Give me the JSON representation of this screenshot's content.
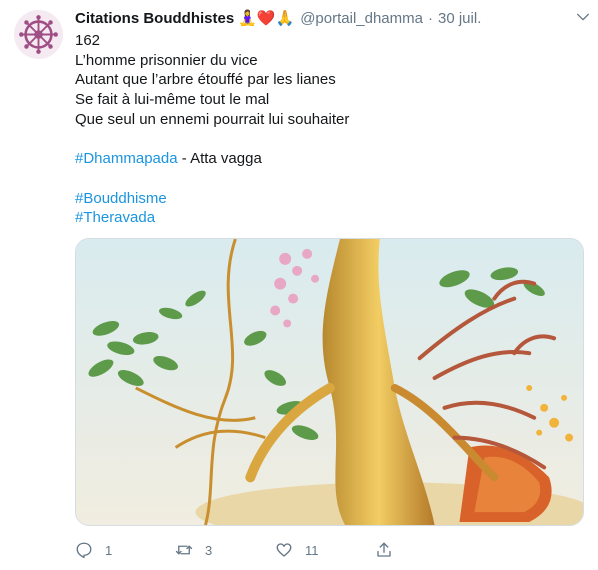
{
  "tweet": {
    "author_name": "Citations Bouddhistes",
    "author_emoji": "🧘‍♀️❤️🙏",
    "handle": "@portail_dhamma",
    "separator": "·",
    "date": "30 juil.",
    "lines": [
      "162",
      "L’homme prisonnier du vice",
      "Autant que l’arbre étouffé par les lianes",
      "Se fait à lui-même tout le mal",
      "Que seul un ennemi pourrait lui souhaiter"
    ],
    "hashtag_dhammapada": "#Dhammapada",
    "after_hashtag": " - Atta vagga",
    "hashtag_bouddhisme": "#Bouddhisme",
    "hashtag_theravada": "#Theravada"
  },
  "actions": {
    "reply_count": "1",
    "retweet_count": "3",
    "like_count": "11"
  },
  "icons": {
    "avatar": "dharma-wheel-icon",
    "caret": "chevron-down-icon",
    "reply": "reply-icon",
    "retweet": "retweet-icon",
    "like": "heart-icon",
    "share": "share-icon"
  },
  "colors": {
    "link": "#1b95e0",
    "muted": "#657786",
    "avatar_accent": "#a04f86"
  }
}
